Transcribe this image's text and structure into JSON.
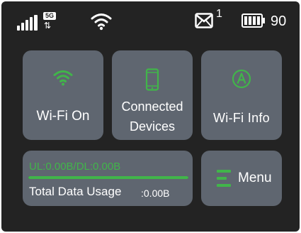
{
  "status_bar": {
    "network_type": "5G",
    "data_arrows": "⇅",
    "unread_messages": "1",
    "battery_level": "90"
  },
  "tiles": {
    "wifi": {
      "label": "Wi-Fi On"
    },
    "devices": {
      "label_line1": "Connected",
      "label_line2": "Devices"
    },
    "wifi_info": {
      "label": "Wi-Fi Info"
    },
    "usage": {
      "rate": "UL:0.00B/DL:0.00B",
      "label": "Total Data Usage",
      "value": ":0.00B",
      "bar_fill_percent": 100
    },
    "menu": {
      "label": "Menu"
    }
  },
  "colors": {
    "accent_green": "#41b54a",
    "tile_bg": "#5f6670",
    "screen_bg": "#232323"
  },
  "icons": {
    "signal": "signal-strength-icon",
    "wifi_status": "wifi-icon",
    "mail": "envelope-icon",
    "battery": "battery-icon",
    "wifi_tile": "wifi-icon",
    "devices_tile": "phone-icon",
    "info_tile": "circle-a-icon",
    "menu_tile": "menu-lines-icon"
  }
}
